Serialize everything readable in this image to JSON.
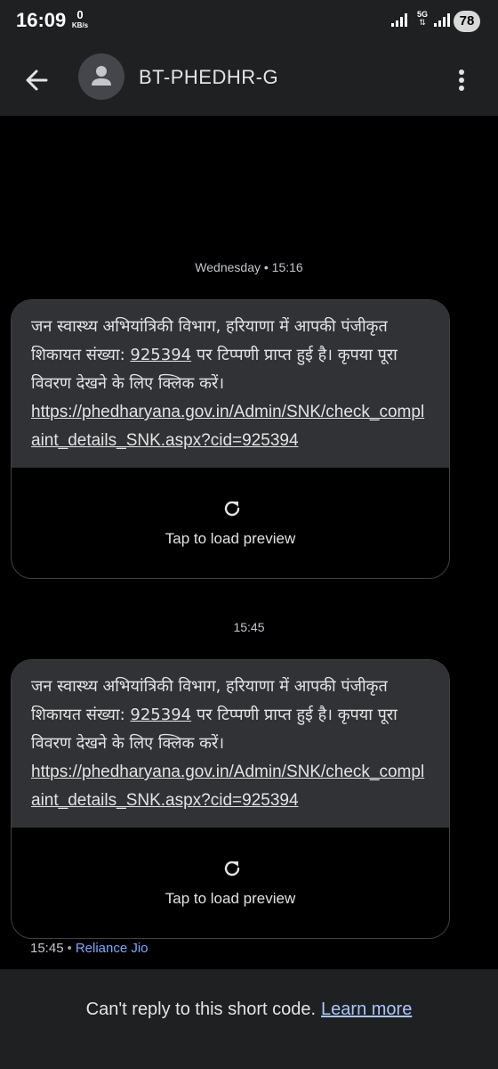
{
  "status_bar": {
    "time": "16:09",
    "net_speed_value": "0",
    "net_speed_unit": "KB/s",
    "network_type": "5G",
    "battery": "78"
  },
  "header": {
    "contact_name": "BT-PHEDHR-G",
    "back_icon": "arrow-back-icon",
    "menu_icon": "more-vert-icon"
  },
  "conversation": {
    "messages": [
      {
        "date_label": "Wednesday • 15:16",
        "text_prefix": "जन स्वास्थ्य अभियांत्रिकी विभाग, हरियाणा में आपकी पंजीकृत शिकायत संख्या: ",
        "complaint_number": "925394",
        "text_suffix": " पर टिप्पणी प्राप्त हुई है। कृपया पूरा विवरण देखने के लिए क्लिक करें।",
        "link": "https://phedharyana.gov.in/Admin/SNK/check_complaint_details_SNK.aspx?cid=925394",
        "preview_label": "Tap to load preview"
      },
      {
        "date_label": "15:45",
        "text_prefix": "जन स्वास्थ्य अभियांत्रिकी विभाग, हरियाणा में आपकी पंजीकृत शिकायत संख्या: ",
        "complaint_number": "925394",
        "text_suffix": " पर टिप्पणी प्राप्त हुई है। कृपया पूरा विवरण देखने के लिए क्लिक करें।",
        "link": "https://phedharyana.gov.in/Admin/SNK/check_complaint_details_SNK.aspx?cid=925394",
        "preview_label": "Tap to load preview"
      }
    ],
    "last_meta": {
      "time": "15:45",
      "separator": "•",
      "carrier": "Reliance Jio"
    }
  },
  "footer": {
    "message": "Can't reply to this short code.",
    "learn_more": "Learn more"
  },
  "colors": {
    "bar_bg": "#1f2022",
    "bubble_bg": "#313235",
    "link_blue": "#a8c7fa",
    "carrier_blue": "#7ea7ff"
  }
}
